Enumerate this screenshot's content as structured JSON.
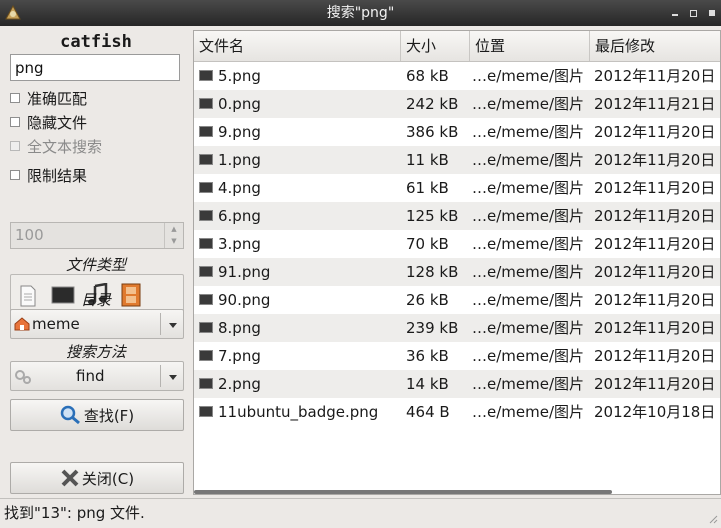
{
  "window": {
    "title": "搜索\"png\""
  },
  "sidebar": {
    "app_name": "catfish",
    "search_value": "png",
    "options": [
      {
        "label": "准确匹配",
        "checked": false,
        "enabled": true
      },
      {
        "label": "隐藏文件",
        "checked": false,
        "enabled": true
      },
      {
        "label": "全文本搜索",
        "checked": false,
        "enabled": false
      },
      {
        "label": "限制结果",
        "checked": false,
        "enabled": true
      }
    ],
    "limit_value": "100",
    "file_types_label": "文件类型",
    "file_type_icons": [
      "document-icon",
      "image-icon",
      "music-icon",
      "video-icon"
    ],
    "directory_label": "目录",
    "directory_value": "meme",
    "method_label": "搜索方法",
    "method_value": "find",
    "find_button": "查找(F)",
    "close_button": "关闭(C)"
  },
  "results": {
    "columns": [
      "文件名",
      "大小",
      "位置",
      "最后修改"
    ],
    "rows": [
      {
        "name": "5.png",
        "size": "68 kB",
        "location": "…e/meme/图片",
        "modified": "2012年11月20日"
      },
      {
        "name": "0.png",
        "size": "242 kB",
        "location": "…e/meme/图片",
        "modified": "2012年11月21日"
      },
      {
        "name": "9.png",
        "size": "386 kB",
        "location": "…e/meme/图片",
        "modified": "2012年11月20日"
      },
      {
        "name": "1.png",
        "size": "11 kB",
        "location": "…e/meme/图片",
        "modified": "2012年11月20日"
      },
      {
        "name": "4.png",
        "size": "61 kB",
        "location": "…e/meme/图片",
        "modified": "2012年11月20日"
      },
      {
        "name": "6.png",
        "size": "125 kB",
        "location": "…e/meme/图片",
        "modified": "2012年11月20日"
      },
      {
        "name": "3.png",
        "size": "70 kB",
        "location": "…e/meme/图片",
        "modified": "2012年11月20日"
      },
      {
        "name": "91.png",
        "size": "128 kB",
        "location": "…e/meme/图片",
        "modified": "2012年11月20日"
      },
      {
        "name": "90.png",
        "size": "26 kB",
        "location": "…e/meme/图片",
        "modified": "2012年11月20日"
      },
      {
        "name": "8.png",
        "size": "239 kB",
        "location": "…e/meme/图片",
        "modified": "2012年11月20日"
      },
      {
        "name": "7.png",
        "size": "36 kB",
        "location": "…e/meme/图片",
        "modified": "2012年11月20日"
      },
      {
        "name": "2.png",
        "size": "14 kB",
        "location": "…e/meme/图片",
        "modified": "2012年11月20日"
      },
      {
        "name": "11ubuntu_badge.png",
        "size": "464 B",
        "location": "…e/meme/图片",
        "modified": "2012年10月18日"
      }
    ]
  },
  "status": {
    "text": "找到\"13\": png 文件."
  },
  "colors": {
    "titlebar": "#333333",
    "window_bg": "#ece9e6",
    "row_alt": "#eeedeb",
    "directory_icon": "#e8743b",
    "find_icon": "#2a6fb8"
  }
}
